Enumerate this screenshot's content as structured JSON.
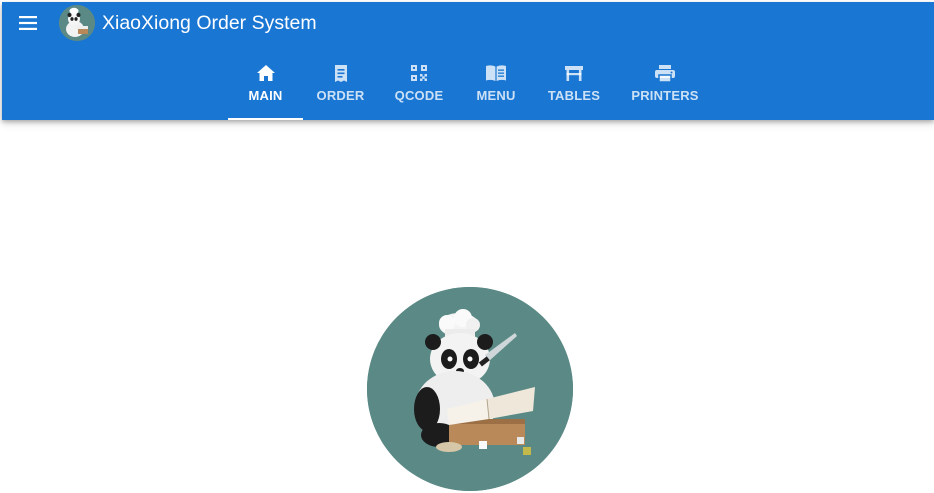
{
  "app": {
    "title": "XiaoXiong Order System"
  },
  "icons": {
    "menu": "menu-icon",
    "logo": "panda-chef-logo",
    "hero": "panda-chef-illustration"
  },
  "tabs": [
    {
      "label": "MAIN",
      "icon": "home-icon",
      "active": true
    },
    {
      "label": "ORDER",
      "icon": "receipt-icon",
      "active": false
    },
    {
      "label": "QCODE",
      "icon": "qr-code-icon",
      "active": false
    },
    {
      "label": "MENU",
      "icon": "book-icon",
      "active": false
    },
    {
      "label": "TABLES",
      "icon": "table-icon",
      "active": false
    },
    {
      "label": "PRINTERS",
      "icon": "printer-icon",
      "active": false
    }
  ],
  "colors": {
    "primary": "#1976d2",
    "text_on_primary": "#ffffff",
    "avatar_bg": "#5b8a86"
  }
}
